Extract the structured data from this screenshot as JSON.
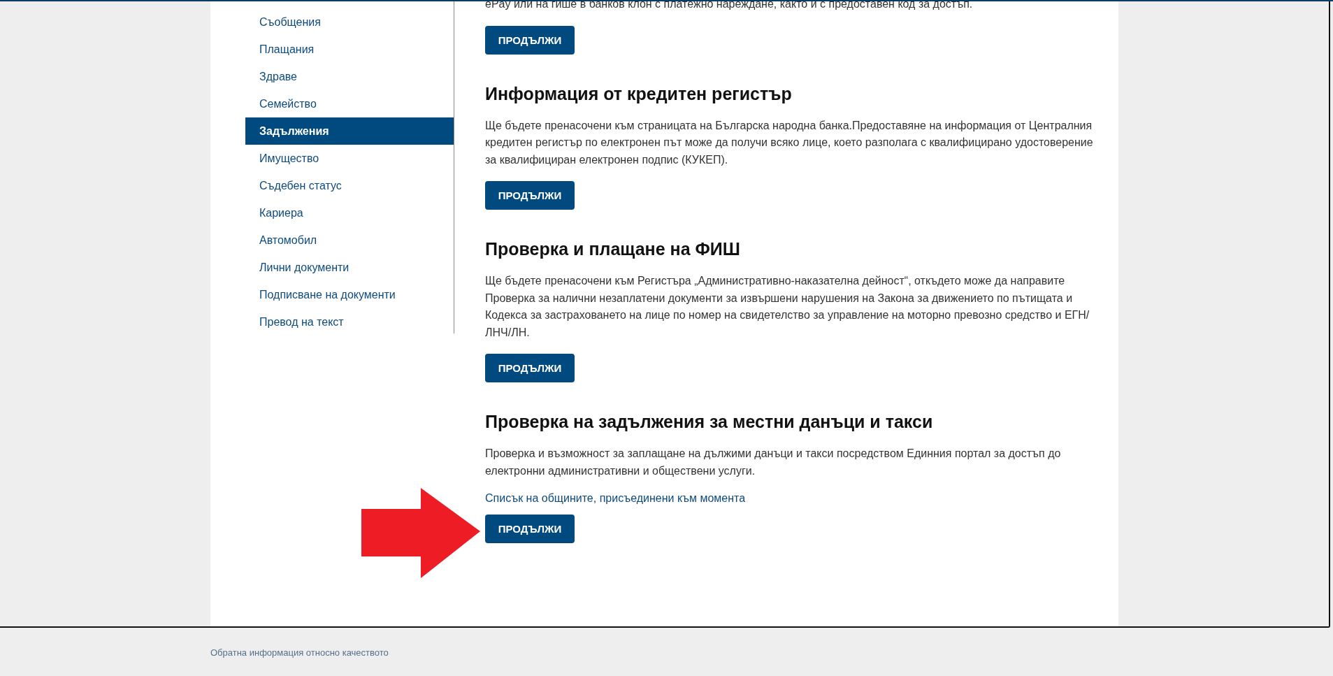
{
  "sidebar": {
    "items": [
      {
        "label": "Съобщения",
        "selected": false
      },
      {
        "label": "Плащания",
        "selected": false
      },
      {
        "label": "Здраве",
        "selected": false
      },
      {
        "label": "Семейство",
        "selected": false
      },
      {
        "label": "Задължения",
        "selected": true
      },
      {
        "label": "Имущество",
        "selected": false
      },
      {
        "label": "Съдебен статус",
        "selected": false
      },
      {
        "label": "Кариера",
        "selected": false
      },
      {
        "label": "Автомобил",
        "selected": false
      },
      {
        "label": "Лични документи",
        "selected": false
      },
      {
        "label": "Подписване на документи",
        "selected": false
      },
      {
        "label": "Превод на текст",
        "selected": false
      }
    ]
  },
  "sections": [
    {
      "text": "ePay или на гише в банков клон с платежно нареждане, както и с предоставен код за достъп.",
      "button": "ПРОДЪЛЖИ"
    },
    {
      "title": "Информация от кредитен регистър",
      "text": "Ще бъдете пренасочени към страницата на Българска народна банка.Предоставяне на информация от Централния кредитен регистър по електронен път може да получи всяко лице, което разполага с квалифицирано удостоверение за квалифициран електронен подпис (КУКЕП).",
      "button": "ПРОДЪЛЖИ"
    },
    {
      "title": "Проверка и плащане на ФИШ",
      "text": "Ще бъдете пренасочени към Регистъра „Административно-наказателна дейност“, откъдето може да направите Проверка за налични незаплатени документи за извършени нарушения на Закона за движението по пътищата и Кодекса за застраховането на лице по номер на свидетелство за управление на моторно превозно средство и ЕГН/ЛНЧ/ЛН.",
      "button": "ПРОДЪЛЖИ"
    },
    {
      "title": "Проверка на задължения за местни данъци и такси",
      "text": "Проверка и възможност за заплащане на дължими данъци и такси посредством Единния портал за достъп до електронни административни и обществени услуги.",
      "link": "Списък на общините, присъединени към момента",
      "button": "ПРОДЪЛЖИ",
      "highlighted": true
    }
  ],
  "footer": {
    "link": "Обратна информация относно качеството"
  }
}
